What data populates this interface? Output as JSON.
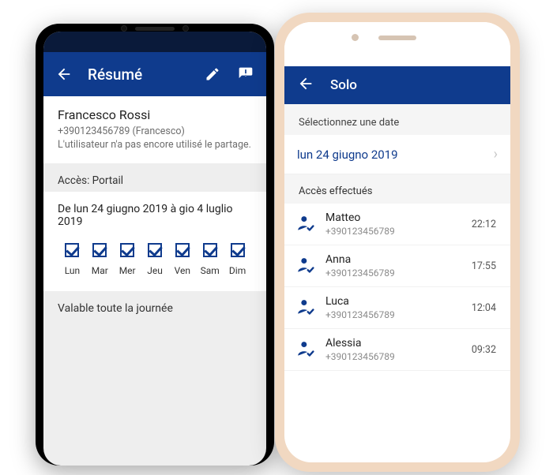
{
  "left": {
    "appbar": {
      "title": "Résumé"
    },
    "user": {
      "name": "Francesco Rossi",
      "phone": "+390123456789 (Francesco)",
      "note": "L'utilisateur n'a pas encore utilisé le partage."
    },
    "access_title": "Accès: Portail",
    "date_range": "De lun 24 giugno 2019 à gio 4 luglio 2019",
    "days": [
      {
        "label": "Lun",
        "checked": true
      },
      {
        "label": "Mar",
        "checked": true
      },
      {
        "label": "Mer",
        "checked": true
      },
      {
        "label": "Jeu",
        "checked": true
      },
      {
        "label": "Ven",
        "checked": true
      },
      {
        "label": "Sam",
        "checked": true
      },
      {
        "label": "Dim",
        "checked": true
      }
    ],
    "validity_note": "Valable toute la journée"
  },
  "right": {
    "appbar": {
      "title": "Solo"
    },
    "date_prompt": "Sélectionnez une date",
    "selected_date": "lun 24 giugno 2019",
    "list_title": "Accès effectués",
    "entries": [
      {
        "name": "Matteo",
        "phone": "+390123456789",
        "time": "22:12"
      },
      {
        "name": "Anna",
        "phone": "+390123456789",
        "time": "17:55"
      },
      {
        "name": "Luca",
        "phone": "+390123456789",
        "time": "12:04"
      },
      {
        "name": "Alessia",
        "phone": "+390123456789",
        "time": "09:32"
      }
    ]
  },
  "colors": {
    "primary": "#0f3b8d"
  }
}
